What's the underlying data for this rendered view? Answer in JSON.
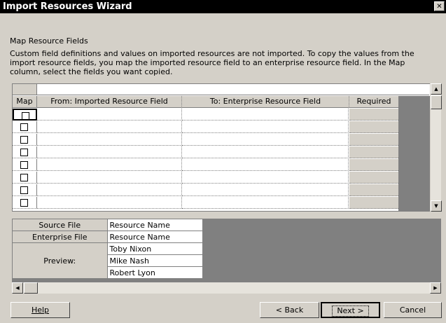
{
  "window": {
    "title": "Import Resources Wizard",
    "close_glyph": "✕"
  },
  "page": {
    "heading": "Map Resource Fields",
    "description": "Custom field definitions and values on imported resources are not imported. To copy the values from the import resource fields, you map the imported resource field to an enterprise resource field.  In the Map column, select the fields you want copied."
  },
  "grid": {
    "headers": {
      "map": "Map",
      "from": "From: Imported Resource Field",
      "to": "To: Enterprise Resource Field",
      "required": "Required"
    },
    "rows": [
      {
        "checked": false,
        "from": "",
        "to": "",
        "required": ""
      },
      {
        "checked": false,
        "from": "",
        "to": "",
        "required": ""
      },
      {
        "checked": false,
        "from": "",
        "to": "",
        "required": ""
      },
      {
        "checked": false,
        "from": "",
        "to": "",
        "required": ""
      },
      {
        "checked": false,
        "from": "",
        "to": "",
        "required": ""
      },
      {
        "checked": false,
        "from": "",
        "to": "",
        "required": ""
      },
      {
        "checked": false,
        "from": "",
        "to": "",
        "required": ""
      },
      {
        "checked": false,
        "from": "",
        "to": "",
        "required": ""
      }
    ]
  },
  "preview": {
    "source_label": "Source File",
    "source_value": "Resource Name",
    "enterprise_label": "Enterprise File",
    "enterprise_value": "Resource Name",
    "preview_label": "Preview:",
    "preview_values": [
      "Toby Nixon",
      "Mike Nash",
      "Robert Lyon"
    ]
  },
  "buttons": {
    "help": "Help",
    "back": "< Back",
    "next": "Next >",
    "cancel": "Cancel"
  },
  "icons": {
    "scroll_up": "▲",
    "scroll_down": "▼",
    "scroll_left": "◀",
    "scroll_right": "▶"
  }
}
